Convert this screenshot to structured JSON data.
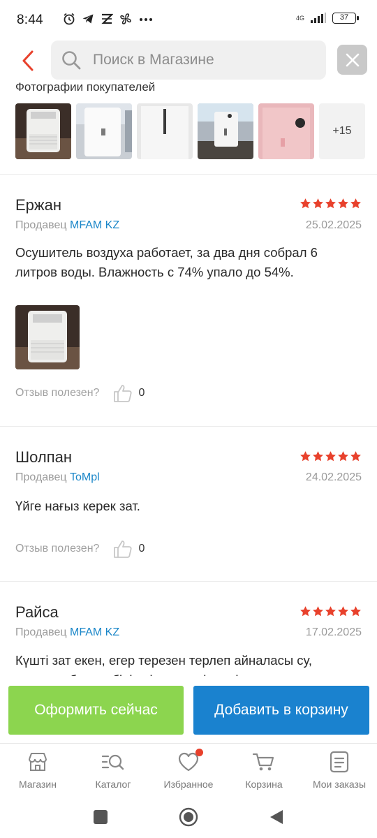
{
  "status_bar": {
    "time": "8:44",
    "network": "4G",
    "battery": "37"
  },
  "header": {
    "search_placeholder": "Поиск в Магазине"
  },
  "photos": {
    "title": "Фотографии покупателей",
    "more_label": "+15"
  },
  "reviews": [
    {
      "name": "Ержан",
      "rating": 5,
      "seller_prefix": "Продавец",
      "seller": "MFAM KZ",
      "date": "25.02.2025",
      "text": "Осушитель воздуха работает, за два дня собрал 6 литров воды. Влажность с 74% упало до 54%.",
      "helpful_label": "Отзыв полезен?",
      "likes": "0"
    },
    {
      "name": "Шолпан",
      "rating": 5,
      "seller_prefix": "Продавец",
      "seller": "ToMpl",
      "date": "24.02.2025",
      "text": "Үйге нағыз керек зат.",
      "helpful_label": "Отзыв полезен?",
      "likes": "0"
    },
    {
      "name": "Райса",
      "rating": 5,
      "seller_prefix": "Продавец",
      "seller": "MFAM KZ",
      "date": "17.02.2025",
      "text": "Күшті зат екен, егер терезен терлеп айналасы су, көгерген болса, бірінші терезені сүртіп ал, осыны"
    }
  ],
  "actions": {
    "buy_now": "Оформить сейчас",
    "add_to_cart": "Добавить в корзину"
  },
  "tabs": [
    {
      "label": "Магазин",
      "icon": "store-icon"
    },
    {
      "label": "Каталог",
      "icon": "catalog-search-icon"
    },
    {
      "label": "Избранное",
      "icon": "heart-icon"
    },
    {
      "label": "Корзина",
      "icon": "cart-icon"
    },
    {
      "label": "Мои заказы",
      "icon": "orders-icon"
    }
  ],
  "colors": {
    "accent_red": "#e8412c",
    "seller_link": "#1a86c8",
    "buy_green": "#8cd54f",
    "cart_blue": "#1a82cf"
  }
}
